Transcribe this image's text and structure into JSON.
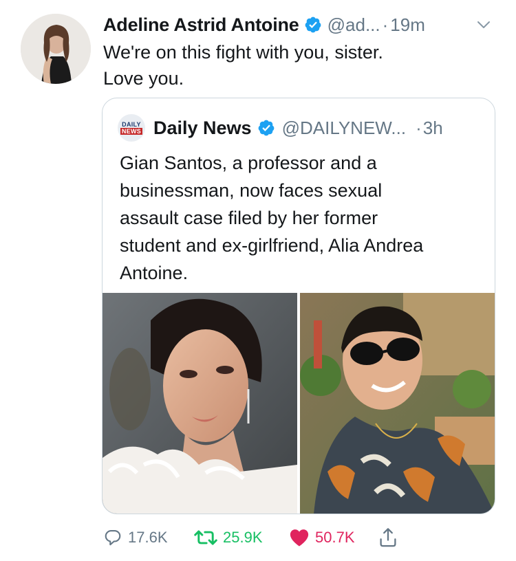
{
  "tweet": {
    "author_name": "Adeline Astrid Antoine",
    "handle": "@ad...",
    "separator": "·",
    "time": "19m",
    "text": "We're on this fight with you, sister.\nLove you."
  },
  "quoted_tweet": {
    "logo_line1": "DAILY",
    "logo_line2": "NEWS",
    "author_name": "Daily News",
    "handle": "@DAILYNEW...",
    "separator": "·",
    "time": "3h",
    "text": "Gian Santos, a professor and a\nbusinessman, now faces sexual\nassault case filed by her former\nstudent and ex-girlfriend, Alia Andrea\nAntoine."
  },
  "actions": {
    "replies": "17.6K",
    "retweets": "25.9K",
    "likes": "50.7K"
  },
  "colors": {
    "verified": "#1da1f2",
    "retweet_active": "#17bf63",
    "like_active": "#e0245e",
    "muted": "#657786"
  },
  "icons": [
    "verified-badge-icon",
    "chevron-down-icon",
    "reply-icon",
    "retweet-icon",
    "heart-icon",
    "share-icon"
  ]
}
